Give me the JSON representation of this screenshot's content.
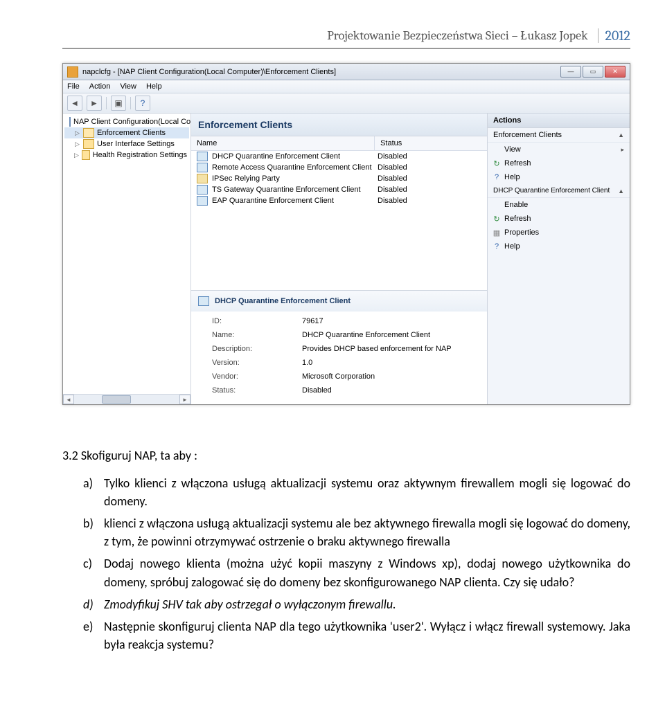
{
  "header": {
    "title": "Projektowanie Bezpieczeństwa Sieci – Łukasz Jopek",
    "year": "2012"
  },
  "window": {
    "title": "napclcfg - [NAP Client Configuration(Local Computer)\\Enforcement Clients]",
    "menu": [
      "File",
      "Action",
      "View",
      "Help"
    ],
    "tree": [
      {
        "label": "NAP Client Configuration(Local Compu",
        "icon": "computer",
        "exp": ""
      },
      {
        "label": "Enforcement Clients",
        "icon": "folder-open",
        "exp": "▷",
        "selected": true
      },
      {
        "label": "User Interface Settings",
        "icon": "folder",
        "exp": "▷",
        "selected": false
      },
      {
        "label": "Health Registration Settings",
        "icon": "folder",
        "exp": "▷",
        "selected": false
      }
    ],
    "mid": {
      "heading": "Enforcement Clients",
      "columns": {
        "name": "Name",
        "status": "Status"
      },
      "rows": [
        {
          "name": "DHCP Quarantine Enforcement Client",
          "status": "Disabled",
          "icon": "client"
        },
        {
          "name": "Remote Access Quarantine Enforcement Client",
          "status": "Disabled",
          "icon": "client"
        },
        {
          "name": "IPSec Relying Party",
          "status": "Disabled",
          "icon": "shield"
        },
        {
          "name": "TS Gateway Quarantine Enforcement Client",
          "status": "Disabled",
          "icon": "client"
        },
        {
          "name": "EAP Quarantine Enforcement Client",
          "status": "Disabled",
          "icon": "client"
        }
      ],
      "detail": {
        "title": "DHCP Quarantine Enforcement Client",
        "fields": [
          {
            "k": "ID:",
            "v": "79617"
          },
          {
            "k": "Name:",
            "v": "DHCP Quarantine Enforcement Client"
          },
          {
            "k": "Description:",
            "v": "Provides DHCP based enforcement for NAP"
          },
          {
            "k": "Version:",
            "v": "1.0"
          },
          {
            "k": "Vendor:",
            "v": "Microsoft Corporation"
          },
          {
            "k": "Status:",
            "v": "Disabled"
          }
        ]
      }
    },
    "actions": {
      "title": "Actions",
      "group1": {
        "heading": "Enforcement Clients",
        "items": [
          "View",
          "Refresh",
          "Help"
        ]
      },
      "group2": {
        "heading": "DHCP Quarantine Enforcement Client",
        "items": [
          "Enable",
          "Refresh",
          "Properties",
          "Help"
        ]
      }
    }
  },
  "body": {
    "heading": "3.2 Skofiguruj NAP, ta aby :",
    "items": [
      {
        "lbl": "a)",
        "text": "Tylko klienci z włączona usługą aktualizacji systemu oraz aktywnym firewallem mogli się logować do domeny."
      },
      {
        "lbl": "b)",
        "text": "klienci z włączona usługą aktualizacji systemu ale bez aktywnego firewalla mogli się logować do domeny, z tym, że powinni otrzymywać ostrzenie o braku aktywnego firewalla"
      },
      {
        "lbl": "c)",
        "text": "Dodaj nowego klienta (można użyć kopii maszyny z Windows xp), dodaj nowego użytkownika do domeny,  spróbuj zalogować się do domeny bez skonfigurowanego NAP clienta. Czy się udało?"
      },
      {
        "lbl": "d)",
        "text": "Zmodyfikuj SHV tak aby ostrzegał o wyłączonym firewallu.",
        "italic": true
      },
      {
        "lbl": "e)",
        "text": "Następnie skonfiguruj clienta NAP dla tego użytkownika 'user2'. Wyłącz i włącz firewall systemowy. Jaka była reakcja systemu?"
      }
    ]
  }
}
